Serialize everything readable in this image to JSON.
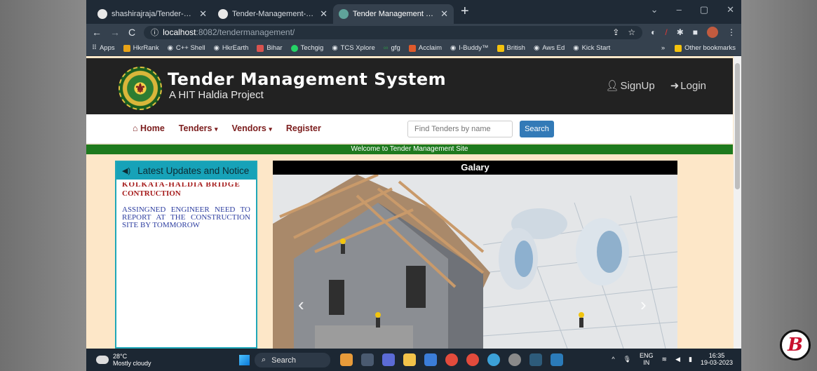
{
  "browser": {
    "tabs": [
      {
        "title": "shashirajraja/Tender-Manageme",
        "icon": "github-icon",
        "active": false
      },
      {
        "title": "Tender-Management-System/ho",
        "icon": "github-icon",
        "active": false
      },
      {
        "title": "Tender Management System",
        "icon": "site-favicon",
        "active": true
      }
    ],
    "new_tab": "+",
    "window_controls": [
      "⌄",
      "–",
      "▢",
      "✕"
    ],
    "url_host": "localhost",
    "url_path": ":8082/tendermanagement/",
    "bookmarks": [
      {
        "label": "Apps",
        "color": "#cfd8e0"
      },
      {
        "label": "HkrRank",
        "color": "#e8a317"
      },
      {
        "label": "C++ Shell",
        "color": "#dfe4ea"
      },
      {
        "label": "HkrEarth",
        "color": "#dfe4ea"
      },
      {
        "label": "Bihar",
        "color": "#d9534f"
      },
      {
        "label": "Techgig",
        "color": "#25d366"
      },
      {
        "label": "TCS Xplore",
        "color": "#dfe4ea"
      },
      {
        "label": "gfg",
        "color": "#2f8d46"
      },
      {
        "label": "Acclaim",
        "color": "#e05a2b"
      },
      {
        "label": "I-Buddy™",
        "color": "#dfe4ea"
      },
      {
        "label": "British",
        "color": "#f4c20d"
      },
      {
        "label": "Aws Ed",
        "color": "#dfe4ea"
      },
      {
        "label": "Kick Start",
        "color": "#dfe4ea"
      }
    ],
    "more_bookmarks": "»",
    "other_bookmarks": "Other bookmarks"
  },
  "site": {
    "title": "Tender Management System",
    "subtitle": "A HIT Haldia Project",
    "signup": "SignUp",
    "login": "Login",
    "nav": {
      "home": "Home",
      "tenders": "Tenders",
      "vendors": "Vendors",
      "register": "Register"
    },
    "search_placeholder": "Find Tenders by name",
    "search_button": "Search",
    "welcome": "Welcome to Tender Management Site",
    "notice": {
      "heading": "Latest Updates and Notice",
      "cut_text": "KOLKATA-HALDIA BRIDGE",
      "title": "CONTRUCTION",
      "text": "ASSINGNED ENGINEER NEED TO REPORT AT THE CONSTRUCTION SITE BY TOMMOROW"
    },
    "gallery": {
      "heading": "Galary",
      "prev": "‹",
      "next": "›"
    }
  },
  "taskbar": {
    "temperature": "28°C",
    "weather": "Mostly cloudy",
    "search": "Search",
    "lang": "ENG",
    "region": "IN",
    "time": "16:35",
    "date": "19-03-2023"
  },
  "corner_logo": "B"
}
